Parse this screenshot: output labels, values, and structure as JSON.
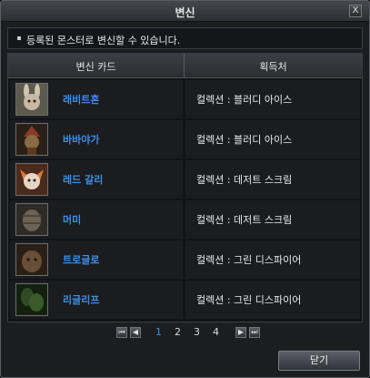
{
  "window": {
    "title": "변신",
    "close_glyph": "X"
  },
  "notice": "등록된 몬스터로 변신할 수 있습니다.",
  "table": {
    "headers": {
      "card": "변신 카드",
      "source": "획득처"
    },
    "rows": [
      {
        "name": "래비트혼",
        "source": "컬렉션 : 블러디 아이스",
        "icon": "rabbit-portrait-icon",
        "color": "#b79a86"
      },
      {
        "name": "바바야가",
        "source": "컬렉션 : 블러디 아이스",
        "icon": "witch-portrait-icon",
        "color": "#7a5a3a"
      },
      {
        "name": "레드 갈리",
        "source": "컬렉션 : 데저트 스크림",
        "icon": "red-creature-portrait-icon",
        "color": "#c96a3b"
      },
      {
        "name": "머미",
        "source": "컬렉션 : 데저트 스크림",
        "icon": "mummy-portrait-icon",
        "color": "#6a5b4c"
      },
      {
        "name": "트로글로",
        "source": "컬렉션 : 그린 디스파이어",
        "icon": "troglodyte-portrait-icon",
        "color": "#5a4230"
      },
      {
        "name": "리글리프",
        "source": "컬렉션 : 그린 디스파이어",
        "icon": "leaf-creature-portrait-icon",
        "color": "#2f4a25"
      }
    ]
  },
  "pagination": {
    "pages": [
      "1",
      "2",
      "3",
      "4"
    ],
    "current": "1",
    "first": "⏮",
    "prev": "◀",
    "next": "▶",
    "last": "⏭"
  },
  "buttons": {
    "close_label": "닫기"
  },
  "colors": {
    "accent": "#3d8fe6",
    "background": "#1b1d20"
  }
}
